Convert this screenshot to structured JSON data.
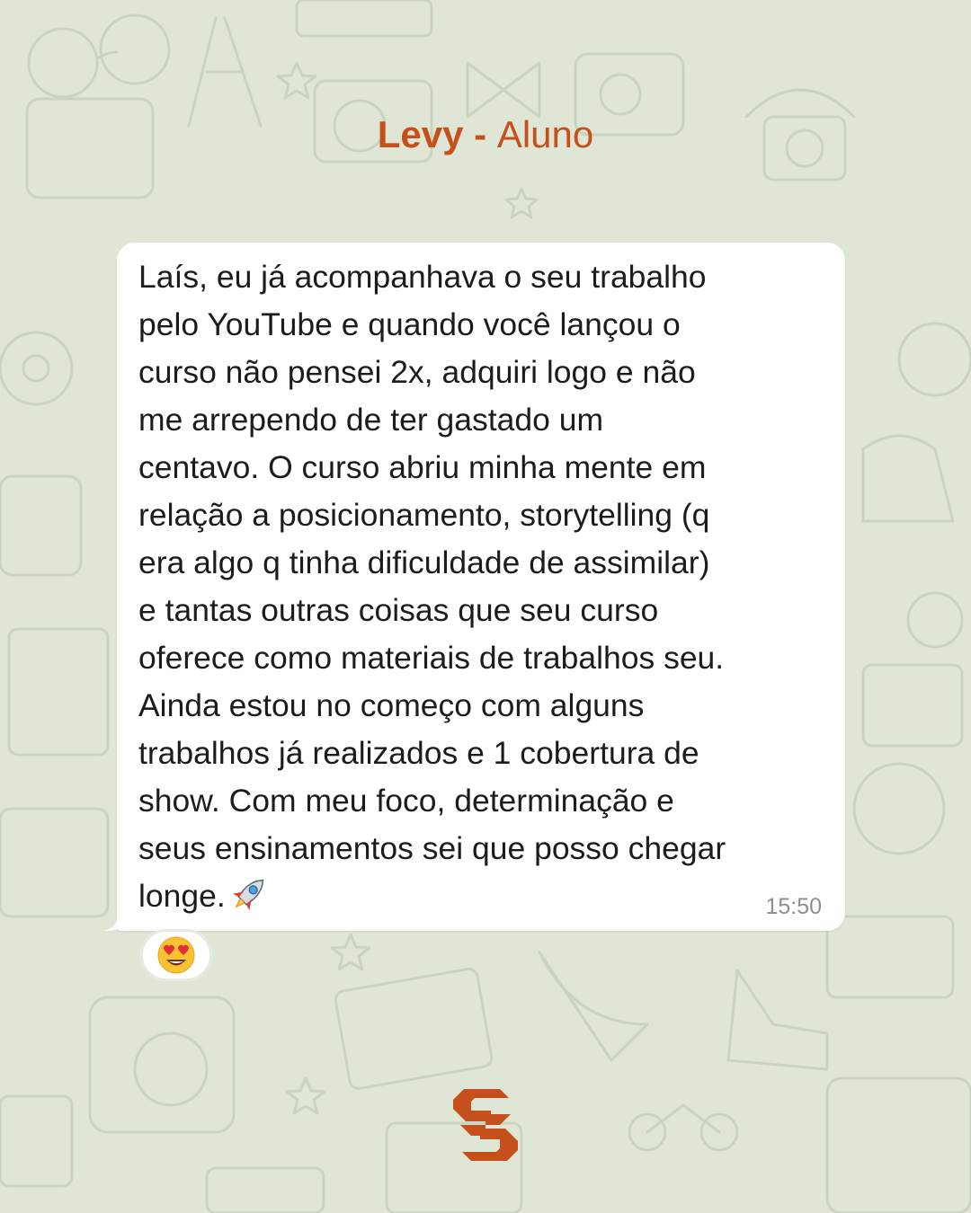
{
  "header": {
    "name": "Levy",
    "separator": " - ",
    "role": "Aluno"
  },
  "message": {
    "text": "Laís, eu já acompanhava o seu trabalho\npelo YouTube e quando você lançou o\ncurso não pensei 2x, adquiri logo e não\nme arrependo de ter gastado um\ncentavo. O curso abriu minha mente em\nrelação a posicionamento, storytelling (q\nera algo q tinha dificuldade de assimilar)\ne tantas outras coisas que seu curso\noferece como materiais de trabalhos seu.\nAinda estou no começo com alguns\ntrabalhos já realizados e 1 cobertura de\nshow. Com meu foco, determinação e\nseus ensinamentos sei que posso chegar\nlonge.",
    "emoji": "rocket-icon",
    "time": "15:50",
    "reaction": "heart-eyes-emoji-icon"
  },
  "colors": {
    "background": "#dfe6d6",
    "pattern": "#c7d2bd",
    "accent": "#c5501b",
    "bubble": "#ffffff",
    "text": "#1c1c1c",
    "timestamp": "#8e8e8e"
  },
  "logo": "brand-logo-icon"
}
